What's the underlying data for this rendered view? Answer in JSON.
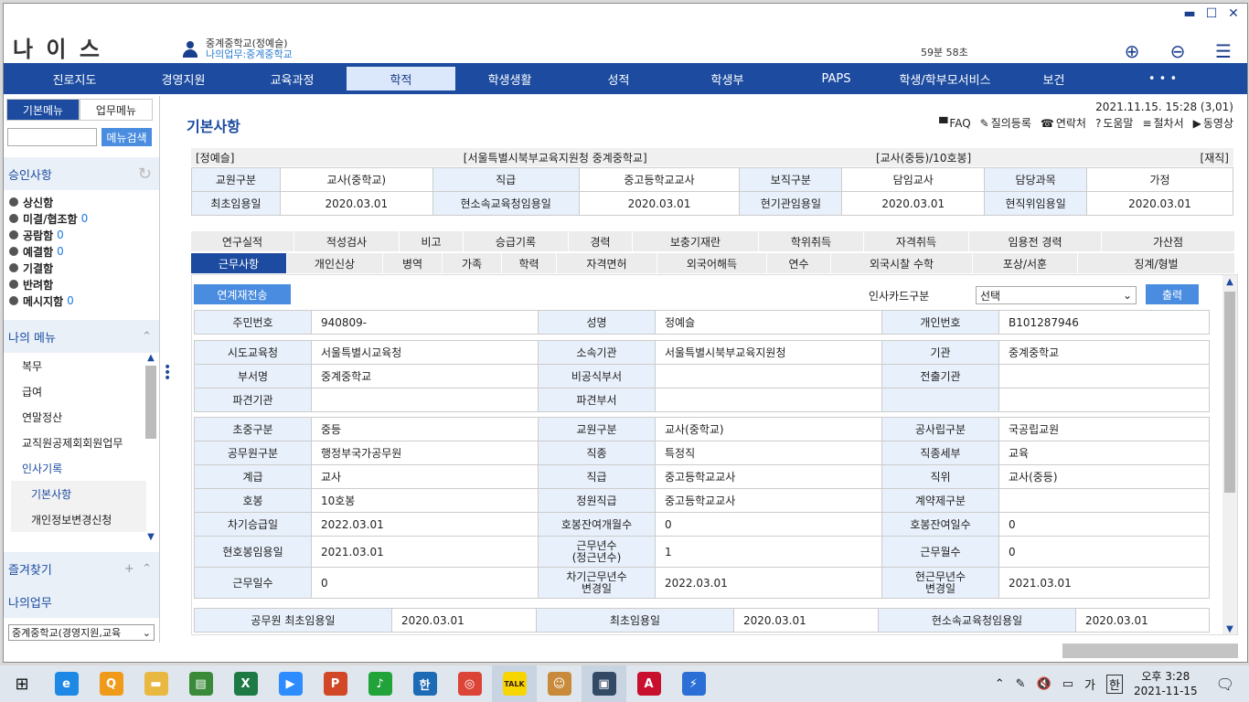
{
  "window": {
    "min": "▬",
    "max": "☐",
    "close": "✕"
  },
  "app": {
    "logo": "나 이 스"
  },
  "user": {
    "name": "중계중학교(정예슬)",
    "dept": "나의업무:중계중학교"
  },
  "timer": "59분 58초",
  "topnav": [
    "진로지도",
    "경영지원",
    "교육과정",
    "학적",
    "학생생활",
    "성적",
    "학생부",
    "PAPS",
    "학생/학부모서비스",
    "보건",
    "• • •"
  ],
  "sidebar": {
    "tabs": [
      "기본메뉴",
      "업무메뉴"
    ],
    "search_btn": "메뉴검색",
    "approval_title": "승인사항",
    "approval": [
      {
        "label": "상신함",
        "count": ""
      },
      {
        "label": "미결/협조함",
        "count": "0"
      },
      {
        "label": "공람함",
        "count": "0"
      },
      {
        "label": "예결함",
        "count": "0"
      },
      {
        "label": "기결함",
        "count": ""
      },
      {
        "label": "반려함",
        "count": ""
      },
      {
        "label": "메시지함",
        "count": "0"
      }
    ],
    "mymenu_title": "나의 메뉴",
    "mymenu": [
      "복무",
      "급여",
      "연말정산",
      "교직원공제회회원업무",
      "인사기록"
    ],
    "mymenu_sub": [
      "기본사항",
      "개인정보변경신청"
    ],
    "favorites": "즐겨찾기",
    "mywork": "나의업무",
    "bottom_select": "중계중학교(경영지원,교육"
  },
  "main": {
    "title": "기본사항",
    "datetime": "2021.11.15. 15:28 (3,01)",
    "tools": [
      "FAQ",
      "질의등록",
      "연락처",
      "도움말",
      "절차서",
      "동영상"
    ],
    "strip": [
      "[정예슬]",
      "[서울특별시북부교육지원청 중계중학교]",
      "[교사(중등)/10호봉]",
      "[재직]"
    ],
    "summary": [
      [
        "교원구분",
        "교사(중학교)",
        "직급",
        "중고등학교교사",
        "보직구분",
        "담임교사",
        "담당과목",
        "가정"
      ],
      [
        "최초임용일",
        "2020.03.01",
        "현소속교육청임용일",
        "2020.03.01",
        "현기관임용일",
        "2020.03.01",
        "현직위임용일",
        "2020.03.01"
      ]
    ],
    "tabs_row1": [
      "연구실적",
      "적성검사",
      "비고",
      "승급기록",
      "경력",
      "보충기재란",
      "학위취득",
      "자격취득",
      "임용전 경력",
      "가산점"
    ],
    "tabs_row2": [
      "근무사항",
      "개인신상",
      "병역",
      "가족",
      "학력",
      "자격면허",
      "외국어해득",
      "연수",
      "외국시찰 수학",
      "포상/서훈",
      "징계/형벌"
    ],
    "transfer_btn": "연계재전송",
    "card_label": "인사카드구분",
    "card_select": "선택",
    "print_btn": "출력",
    "block1": [
      [
        "주민번호",
        "940809-",
        "성명",
        "정예슬",
        "개인번호",
        "B101287946"
      ]
    ],
    "block2": [
      [
        "시도교육청",
        "서울특별시교육청",
        "소속기관",
        "서울특별시북부교육지원청",
        "기관",
        "중계중학교"
      ],
      [
        "부서명",
        "중계중학교",
        "비공식부서",
        "",
        "전출기관",
        ""
      ],
      [
        "파견기관",
        "",
        "파견부서",
        "",
        "",
        ""
      ]
    ],
    "block3": [
      [
        "초중구분",
        "중등",
        "교원구분",
        "교사(중학교)",
        "공사립구분",
        "국공립교원"
      ],
      [
        "공무원구분",
        "행정부국가공무원",
        "직종",
        "특정직",
        "직종세부",
        "교육"
      ],
      [
        "계급",
        "교사",
        "직급",
        "중고등학교교사",
        "직위",
        "교사(중등)"
      ],
      [
        "호봉",
        "10호봉",
        "정원직급",
        "중고등학교교사",
        "계약제구분",
        ""
      ],
      [
        "차기승급일",
        "2022.03.01",
        "호봉잔여개월수",
        "0",
        "호봉잔여일수",
        "0"
      ],
      [
        "현호봉임용일",
        "2021.03.01",
        "근무년수\n(정근년수)",
        "1",
        "근무월수",
        "0"
      ],
      [
        "근무일수",
        "0",
        "차기근무년수\n변경일",
        "2022.03.01",
        "현근무년수\n변경일",
        "2021.03.01"
      ]
    ],
    "block4": [
      "공무원 최초임용일",
      "2020.03.01",
      "최초임용일",
      "2020.03.01",
      "현소속교육청임용일",
      "2020.03.01"
    ]
  },
  "taskbar": {
    "apps": [
      {
        "name": "ie-icon",
        "glyph": "e",
        "color": "#1e88e5"
      },
      {
        "name": "search-app-icon",
        "glyph": "Q",
        "color": "#f09a1a"
      },
      {
        "name": "folder-icon",
        "glyph": "▬",
        "color": "#e9b840"
      },
      {
        "name": "hwp-doc-icon",
        "glyph": "▤",
        "color": "#3a8a3a"
      },
      {
        "name": "excel-icon",
        "glyph": "X",
        "color": "#1d7a45"
      },
      {
        "name": "zoom-icon",
        "glyph": "▶",
        "color": "#2d8cff"
      },
      {
        "name": "powerpoint-icon",
        "glyph": "P",
        "color": "#d24726"
      },
      {
        "name": "green-app-icon",
        "glyph": "♪",
        "color": "#22a33a"
      },
      {
        "name": "hancom-icon",
        "glyph": "한",
        "color": "#1d6bb5"
      },
      {
        "name": "chrome-icon",
        "glyph": "◎",
        "color": "#db4437"
      },
      {
        "name": "kakaotalk-icon",
        "glyph": "TALK",
        "color": "#3a1d1d"
      },
      {
        "name": "avatar-app-icon",
        "glyph": "☺",
        "color": "#c98a3c"
      },
      {
        "name": "screen-app-icon",
        "glyph": "▣",
        "color": "#334a66"
      },
      {
        "name": "pdf-icon",
        "glyph": "A",
        "color": "#c8102e"
      },
      {
        "name": "bolt-app-icon",
        "glyph": "⚡",
        "color": "#2b6fd6"
      }
    ],
    "tray_ime": "가",
    "tray_han": "한",
    "clock_time": "오후 3:28",
    "clock_date": "2021-11-15"
  }
}
